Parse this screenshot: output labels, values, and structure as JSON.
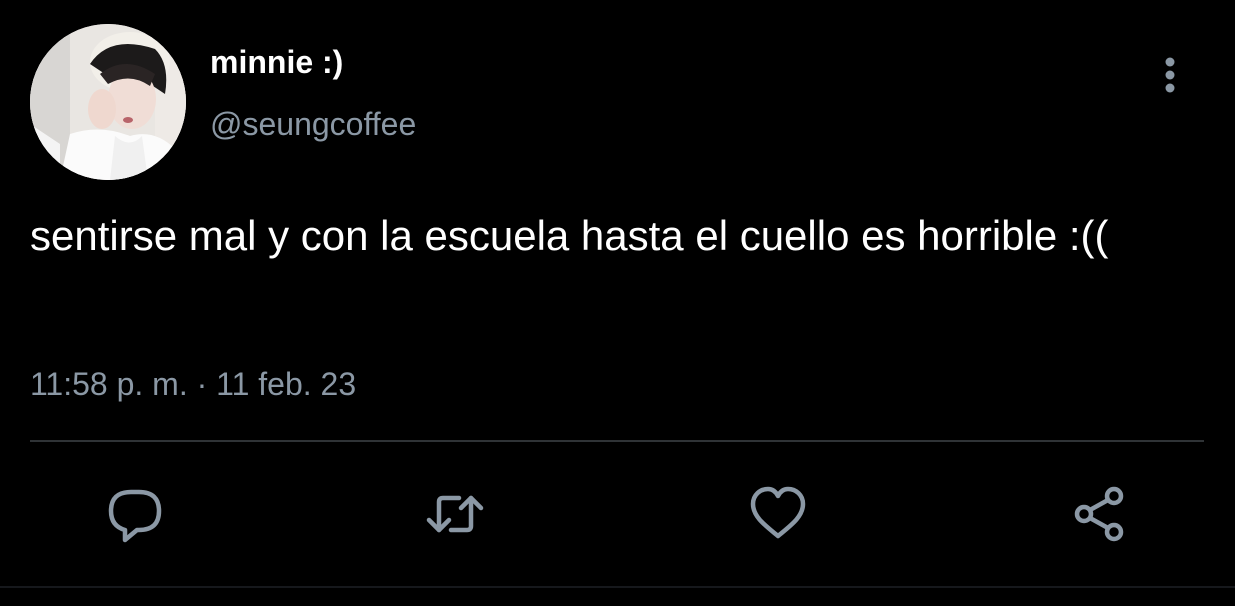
{
  "tweet": {
    "display_name": "minnie :)",
    "handle": "@seungcoffee",
    "text": "sentirse mal y con la escuela hasta el cuello es horrible :((",
    "timestamp": "11:58 p. m. · 11 feb. 23"
  },
  "icons": {
    "more": "more-vertical-icon",
    "reply": "reply-icon",
    "retweet": "retweet-icon",
    "like": "heart-icon",
    "share": "share-icon"
  },
  "colors": {
    "background": "#000000",
    "text_primary": "#ffffff",
    "text_secondary": "#8b98a5",
    "divider": "#2f3336"
  }
}
